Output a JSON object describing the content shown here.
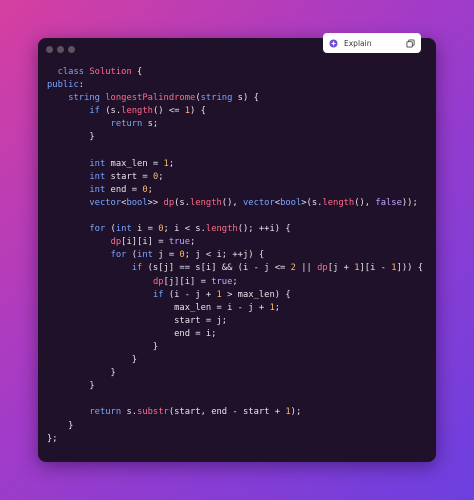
{
  "toolbar": {
    "explain_label": "Explain",
    "explain_icon": "sparkle-icon",
    "copy_icon": "copy-icon"
  },
  "window_dots": [
    "#5b5360",
    "#5b5360",
    "#5b5360"
  ],
  "code_lines": [
    "  class Solution {",
    "public:",
    "    string longestPalindrome(string s) {",
    "        if (s.length() <= 1) {",
    "            return s;",
    "        }",
    "",
    "        int max_len = 1;",
    "        int start = 0;",
    "        int end = 0;",
    "        vector<bool>> dp(s.length(), vector<bool>(s.length(), false));",
    "",
    "        for (int i = 0; i < s.length(); ++i) {",
    "            dp[i][i] = true;",
    "            for (int j = 0; j < i; ++j) {",
    "                if (s[j] == s[i] && (i - j <= 2 || dp[j + 1][i - 1])) {",
    "                    dp[j][i] = true;",
    "                    if (i - j + 1 > max_len) {",
    "                        max_len = i - j + 1;",
    "                        start = j;",
    "                        end = i;",
    "                    }",
    "                }",
    "            }",
    "        }",
    "",
    "        return s.substr(start, end - start + 1);",
    "    }",
    "};"
  ]
}
